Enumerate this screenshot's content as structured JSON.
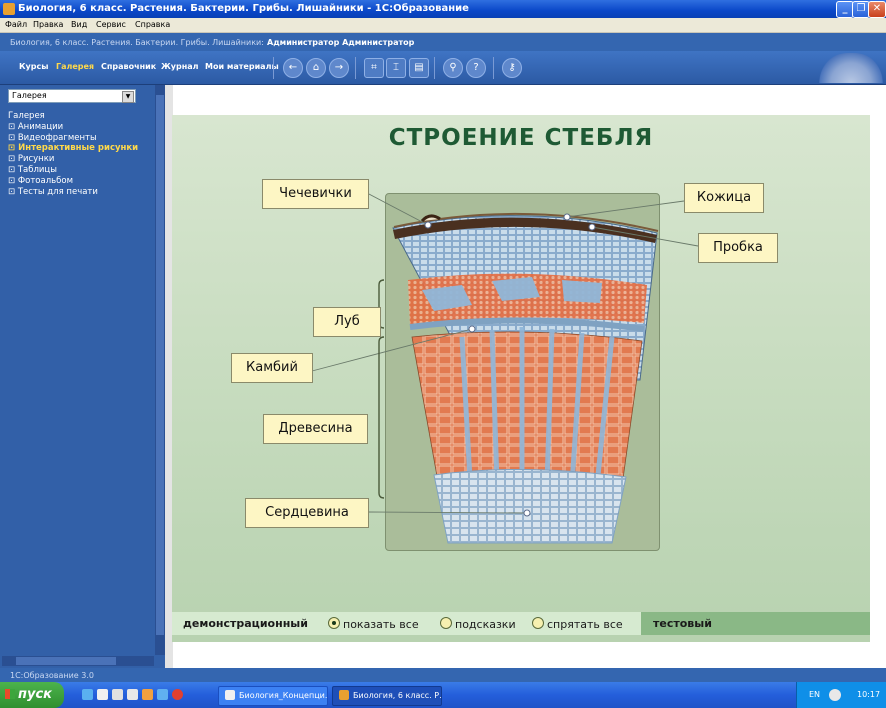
{
  "window": {
    "title": "Биология, 6 класс. Растения. Бактерии. Грибы. Лишайники - 1С:Образование",
    "minimize": "_",
    "maximize": "❐",
    "close": "✕"
  },
  "menu": [
    "Файл",
    "Правка",
    "Вид",
    "Сервис",
    "Справка"
  ],
  "header": {
    "course": "Биология, 6 класс. Растения. Бактерии. Грибы. Лишайники:",
    "user": "Администратор Администратор"
  },
  "toolbar": {
    "tabs": [
      "Курсы",
      "Галерея",
      "Справочник",
      "Журнал",
      "Мои материалы"
    ],
    "active_tab": "Галерея",
    "icons": [
      "back-icon",
      "home-icon",
      "forward-icon",
      "fit-icon",
      "bookmark-icon",
      "print-icon",
      "search-icon",
      "help-icon",
      "key-icon"
    ]
  },
  "sidebar": {
    "select_value": "Галерея",
    "tree_head": "Галерея",
    "items": [
      {
        "label": "Анимации"
      },
      {
        "label": "Видеофрагменты"
      },
      {
        "label": "Интерактивные рисунки"
      },
      {
        "label": "Рисунки"
      },
      {
        "label": "Таблицы"
      },
      {
        "label": "Фотоальбом"
      },
      {
        "label": "Тесты для печати"
      }
    ],
    "active_item": "Интерактивные рисунки"
  },
  "diagram": {
    "title": "СТРОЕНИЕ  СТЕБЛЯ",
    "labels": {
      "chechevichki": "Чечевички",
      "kozhitsa": "Кожица",
      "probka": "Пробка",
      "lub": "Луб",
      "kambiy": "Камбий",
      "drevesina": "Древесина",
      "serdtsevina": "Сердцевина"
    },
    "colors": {
      "background": "#c8dcc0",
      "wood": "#e07a52",
      "vessels": "#9ec4df",
      "cork": "#4a3020",
      "label_fill": "#fdf6c4"
    }
  },
  "modes": {
    "demo": "демонстрационный",
    "options": [
      "показать все",
      "подсказки",
      "спрятать все"
    ],
    "selected": "показать все",
    "test": "тестовый"
  },
  "status": "1С:Образование 3.0",
  "taskbar": {
    "start": "пуск",
    "tasks": [
      "Биология_Концепци...",
      "Биология, 6 класс. Р..."
    ],
    "lang": "EN",
    "clock": "10:17"
  }
}
